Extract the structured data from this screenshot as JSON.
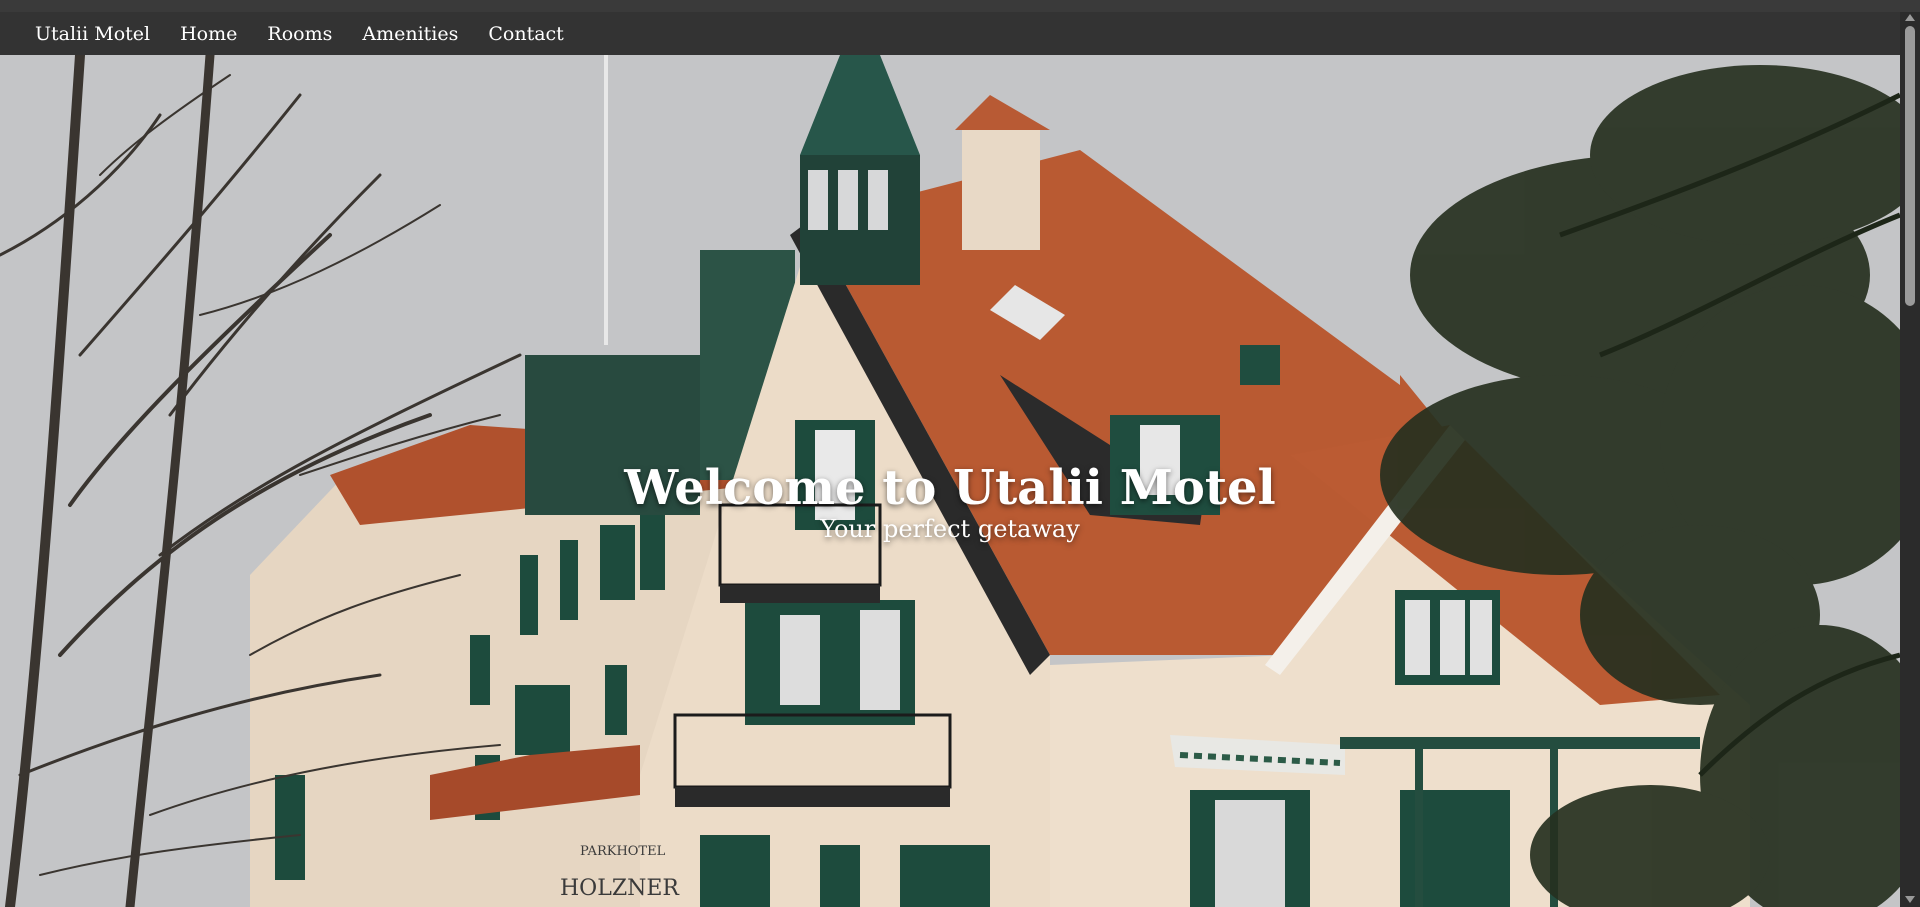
{
  "nav": {
    "brand": "Utalii Motel",
    "items": [
      {
        "label": "Home"
      },
      {
        "label": "Rooms"
      },
      {
        "label": "Amenities"
      },
      {
        "label": "Contact"
      }
    ]
  },
  "hero": {
    "title": "Welcome to Utalii Motel",
    "subtitle": "Your perfect getaway",
    "image": "hotel-building-photo",
    "sign_line1": "PARKHOTEL",
    "sign_line2": "HOLZNER"
  },
  "colors": {
    "navbar": "#333333",
    "nav_text": "#ffffff",
    "roof": "#b8532c",
    "wall": "#e8d8c4",
    "shutters": "#1f4f3f"
  },
  "icons": {
    "scroll_up": "chevron-up-icon",
    "scroll_down": "chevron-down-icon"
  }
}
